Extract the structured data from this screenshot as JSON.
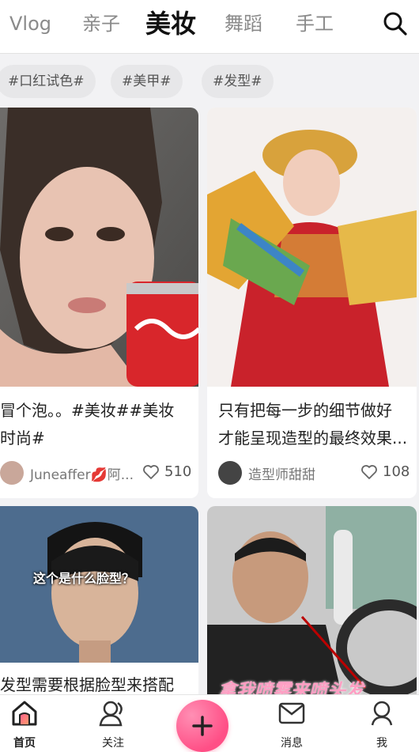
{
  "top_tabs": [
    "Vlog",
    "亲子",
    "美妆",
    "舞蹈",
    "手工"
  ],
  "active_tab": "美妆",
  "hashtags": [
    "#口红试色#",
    "#美甲#",
    "#发型#"
  ],
  "cards": [
    {
      "title": "冒个泡。。#美妆##美妆\n时尚#",
      "author": "Juneaffer💋阿...",
      "likes": "510"
    },
    {
      "title": "只有把每一步的细节做好\n才能呈现造型的最终效果...",
      "author": "造型师甜甜",
      "likes": "108"
    },
    {
      "overlay_text": "这个是什么脸型？",
      "title": "发型需要根据脸型来搭配"
    },
    {
      "overlay_text": "拿我喷雾来喷头发"
    }
  ],
  "bottom_nav": {
    "home": "首页",
    "follow": "关注",
    "messages": "消息",
    "me": "我"
  },
  "colors": {
    "accent": "#ff4f86",
    "highlight_box": "#c0392b"
  }
}
